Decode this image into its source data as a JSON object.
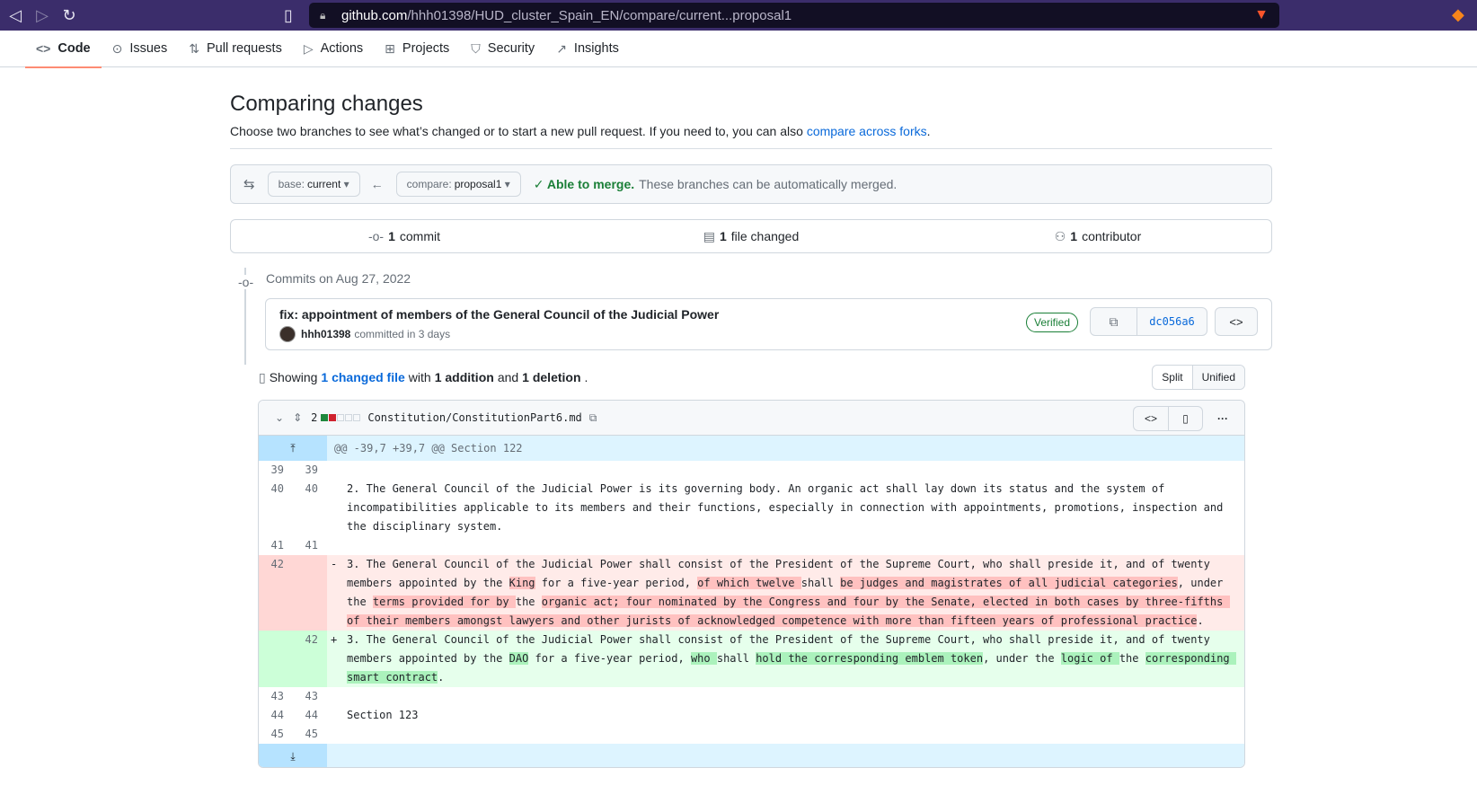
{
  "browser": {
    "url_host": "github.com",
    "url_path": "/hhh01398/HUD_cluster_Spain_EN/compare/current...proposal1"
  },
  "repo_nav": [
    {
      "label": "Code",
      "icon": "code-icon"
    },
    {
      "label": "Issues",
      "icon": "issue-icon"
    },
    {
      "label": "Pull requests",
      "icon": "pull-request-icon"
    },
    {
      "label": "Actions",
      "icon": "play-icon"
    },
    {
      "label": "Projects",
      "icon": "table-icon"
    },
    {
      "label": "Security",
      "icon": "shield-icon"
    },
    {
      "label": "Insights",
      "icon": "graph-icon"
    }
  ],
  "page": {
    "title": "Comparing changes",
    "subtitle": "Choose two branches to see what’s changed or to start a new pull request. If you need to, you can also",
    "subtitle_link": "compare across forks",
    "subtitle_end": "."
  },
  "range": {
    "base_prefix": "base:",
    "base": "current",
    "compare_prefix": "compare:",
    "compare": "proposal1",
    "merge_status": "Able to merge.",
    "merge_desc": "These branches can be automatically merged."
  },
  "stats": {
    "commits_count": "1",
    "commits_label": "commit",
    "files_count": "1",
    "files_label": "file changed",
    "contributors_count": "1",
    "contributors_label": "contributor"
  },
  "commits": {
    "date_label": "Commits on Aug 27, 2022",
    "message": "fix: appointment of members of the General Council of the Judicial Power",
    "author": "hhh01398",
    "meta": "committed in 3 days",
    "badge": "Verified",
    "sha": "dc056a6"
  },
  "diff": {
    "showing": "Showing",
    "changed_files": "1 changed file",
    "with": "with",
    "additions": "1 addition",
    "and": "and",
    "deletions": "1 deletion",
    "period": ".",
    "split_label": "Split",
    "unified_label": "Unified",
    "file": {
      "change_count": "2",
      "path": "Constitution/ConstitutionPart6.md",
      "hunk_header": "@@ -39,7 +39,7 @@ Section 122",
      "lines": [
        {
          "old": "39",
          "new": "39",
          "text": ""
        },
        {
          "old": "40",
          "new": "40",
          "text": "2. The General Council of the Judicial Power is its governing body. An organic act shall lay down its status and the system of incompatibilities applicable to its members and their functions, especially in connection with appointments, promotions, inspection and the disciplinary system."
        },
        {
          "old": "41",
          "new": "41",
          "text": ""
        },
        {
          "old": "43",
          "new": "43",
          "text": ""
        },
        {
          "old": "44",
          "new": "44",
          "text": "Section 123"
        },
        {
          "old": "45",
          "new": "45",
          "text": ""
        }
      ],
      "del_line": {
        "old": "42",
        "sign": "-"
      },
      "add_line": {
        "new": "42",
        "sign": "+"
      },
      "del_parts": [
        "3. The General Council of the Judicial Power shall consist of the President of the Supreme Court, who shall preside it, and of twenty members appointed by the ",
        "King",
        " for a five-year period, ",
        "of which twelve ",
        "shall ",
        "be judges and magistrates of all judicial categories",
        ", under the ",
        "terms provided for by ",
        "the ",
        "organic act; four nominated by the Congress and four by the Senate, elected in both cases by three-fifths of their members amongst lawyers and other jurists of acknowledged competence with more than fifteen years of professional practice",
        "."
      ],
      "add_parts": [
        "3. The General Council of the Judicial Power shall consist of the President of the Supreme Court, who shall preside it, and of twenty members appointed by the ",
        "DAO",
        " for a five-year period, ",
        "who ",
        "shall ",
        "hold the corresponding emblem token",
        ", under the ",
        "logic of ",
        "the ",
        "corresponding smart contract",
        "."
      ]
    }
  }
}
